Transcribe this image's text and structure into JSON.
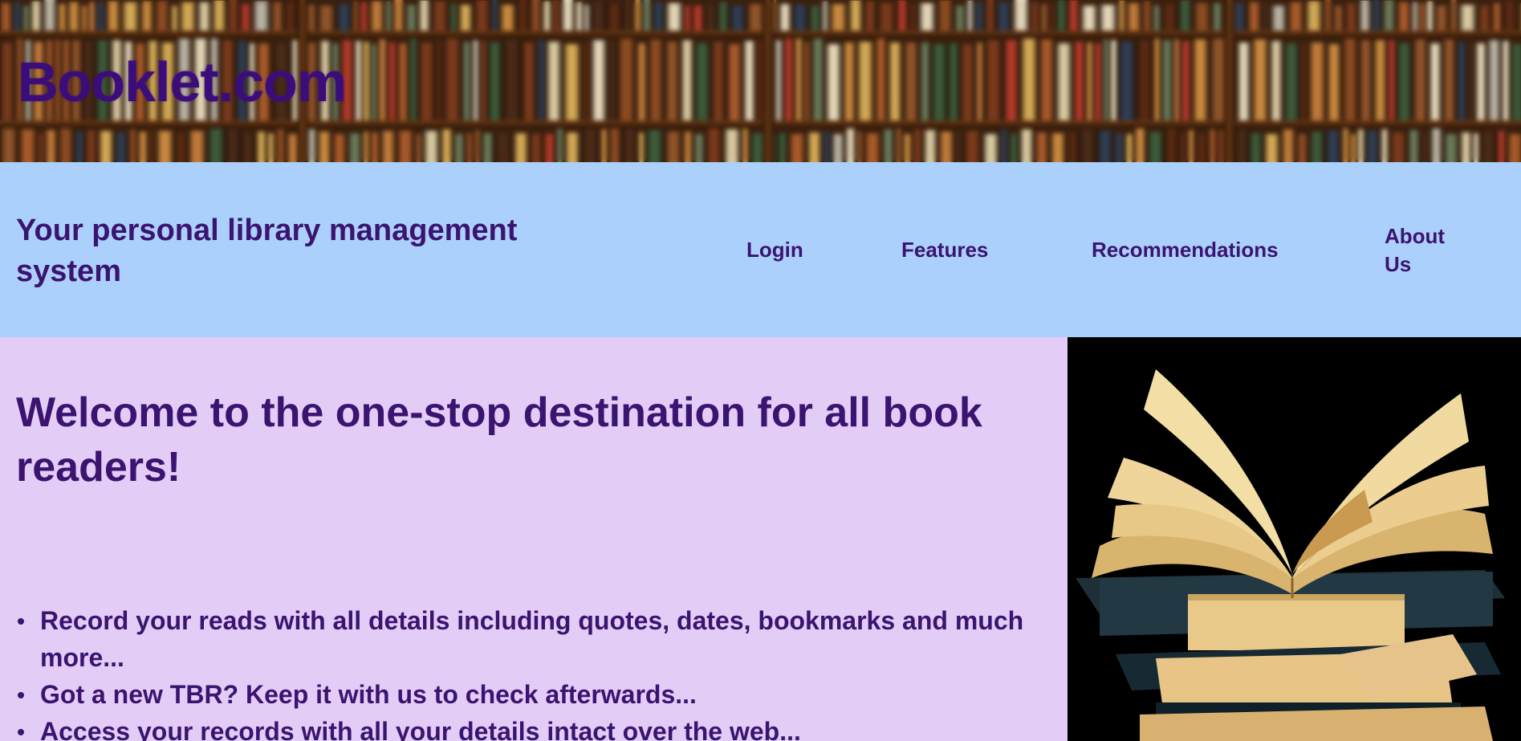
{
  "site": {
    "title": "Booklet.com",
    "tagline": "Your personal library management system"
  },
  "nav": {
    "login": "Login",
    "features": "Features",
    "recommendations": "Recommendations",
    "about": "About Us"
  },
  "main": {
    "heading": "Welcome to the one-stop destination for all book readers!",
    "features": [
      "Record your reads with all details including quotes, dates, bookmarks and much more...",
      "Got a new TBR? Keep it with us to check afterwards...",
      "Access your records with all your details intact over the web..."
    ]
  },
  "images": {
    "banner": "bookshelf-banner-image",
    "side": "open-book-stack-image"
  },
  "colors": {
    "nav_band": "#acd0fc",
    "main_bg": "#e3cdf6",
    "text": "#3a1470",
    "title": "#3b0d7a",
    "side_bg": "#000000"
  }
}
